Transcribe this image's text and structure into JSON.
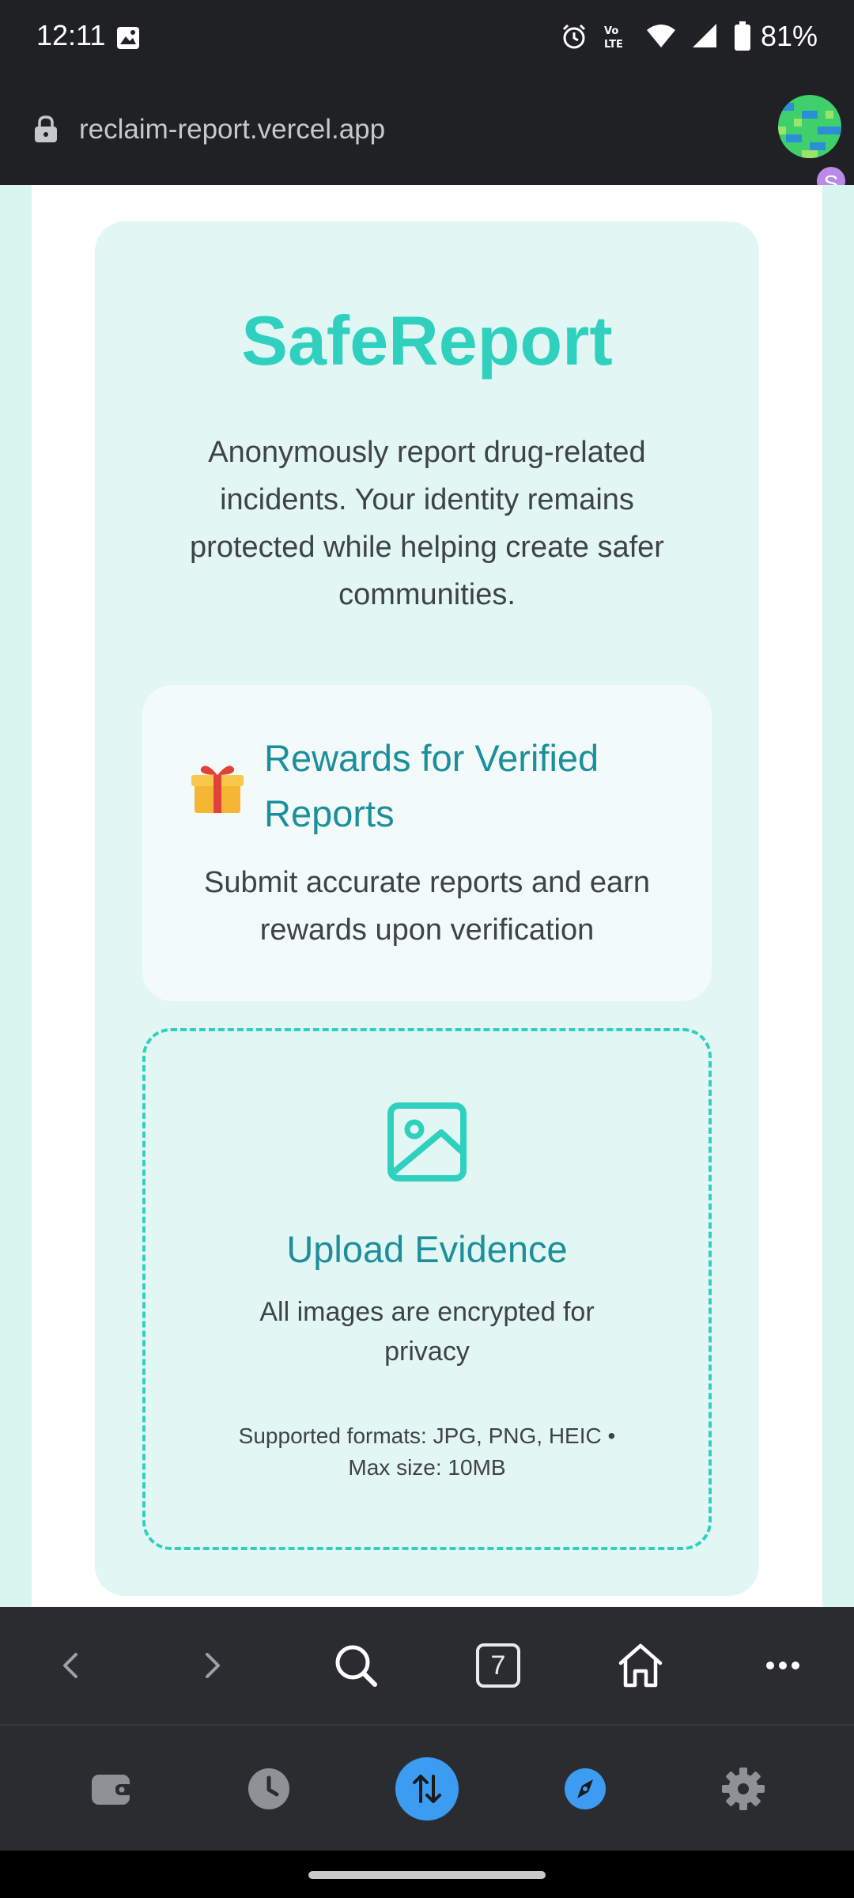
{
  "status_bar": {
    "time": "12:11",
    "battery": "81%",
    "icons": [
      "photos-icon",
      "alarm-icon",
      "volte-icon",
      "wifi-icon",
      "signal-icon",
      "battery-icon"
    ]
  },
  "address_bar": {
    "url": "reclaim-report.vercel.app",
    "profile_badge": "S"
  },
  "page": {
    "title": "SafeReport",
    "intro": "Anonymously report drug-related incidents. Your identity remains protected while helping create safer communities.",
    "rewards": {
      "title": "Rewards for Verified Reports",
      "text": "Submit accurate reports and earn rewards upon verification",
      "icon": "gift-icon"
    },
    "upload": {
      "title": "Upload Evidence",
      "text": "All images are encrypted for privacy",
      "formats": "Supported formats: JPG, PNG, HEIC • Max size: 10MB",
      "icon": "image-icon"
    }
  },
  "toolbar": {
    "tabs_count": "7",
    "items": [
      "back-icon",
      "forward-icon",
      "search-icon",
      "tabs-icon",
      "home-icon",
      "more-icon"
    ]
  },
  "bottom_bar": {
    "items": [
      "wallet-icon",
      "history-icon",
      "transfer-icon",
      "compass-icon",
      "settings-icon"
    ],
    "active": "transfer-icon"
  },
  "colors": {
    "accent": "#2fd1be",
    "heading": "#1d8f9c",
    "card_bg": "#e2f7f3",
    "active_button": "#3c9cf2"
  }
}
